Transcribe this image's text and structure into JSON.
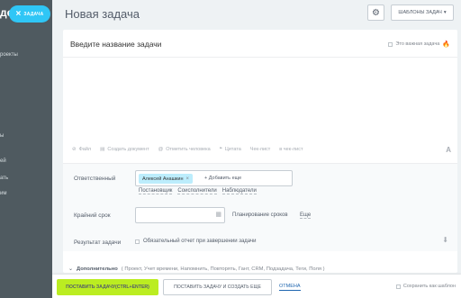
{
  "background_app": {
    "title": "де",
    "lines": [
      "роекты",
      "ы",
      "ей",
      "ать",
      "им"
    ]
  },
  "close_pill": {
    "label": "ЗАДАЧА"
  },
  "header": {
    "title": "Новая задача",
    "templates_label": "ШАБЛОНЫ ЗАДАЧ"
  },
  "card": {
    "title_placeholder": "Введите название задачи",
    "important_label": "Это важная задача"
  },
  "toolbar": {
    "items": [
      "Файл",
      "Создать документ",
      "Отметить человека",
      "Цитата",
      "Чек-лист",
      "в чек-лист"
    ],
    "format_label": "A"
  },
  "props": {
    "responsible_label": "Ответственный",
    "responsible_person": "Алексей Анашкин",
    "add_more": "+ Добавить еще",
    "roles": [
      "Постановщик",
      "Соисполнители",
      "Наблюдатели"
    ],
    "deadline_label": "Крайний срок",
    "planning_label": "Планирование сроков",
    "more_label": "Еще",
    "result_label": "Результат задачи",
    "result_check_label": "Обязательный отчет при завершении задачи"
  },
  "extra": {
    "title": "Дополнительно",
    "items": "( Проект,  Учет времени,  Напомнить,  Повторять,  Гант,  CRM,  Подзадача,  Теги,  Поля )"
  },
  "footer": {
    "primary_label": "ПОСТАВИТЬ ЗАДАЧУ(CTRL+ENTER)",
    "secondary_label": "ПОСТАВИТЬ ЗАДАЧУ И СОЗДАТЬ ЕЩЕ",
    "cancel_label": "ОТМЕНА",
    "save_template_label": "Сохранить как шаблон"
  },
  "colors": {
    "accent_blue": "#2fc6f6",
    "primary_green": "#bbed21",
    "chip_blue": "#bcedfc",
    "link_blue": "#2067b0"
  }
}
